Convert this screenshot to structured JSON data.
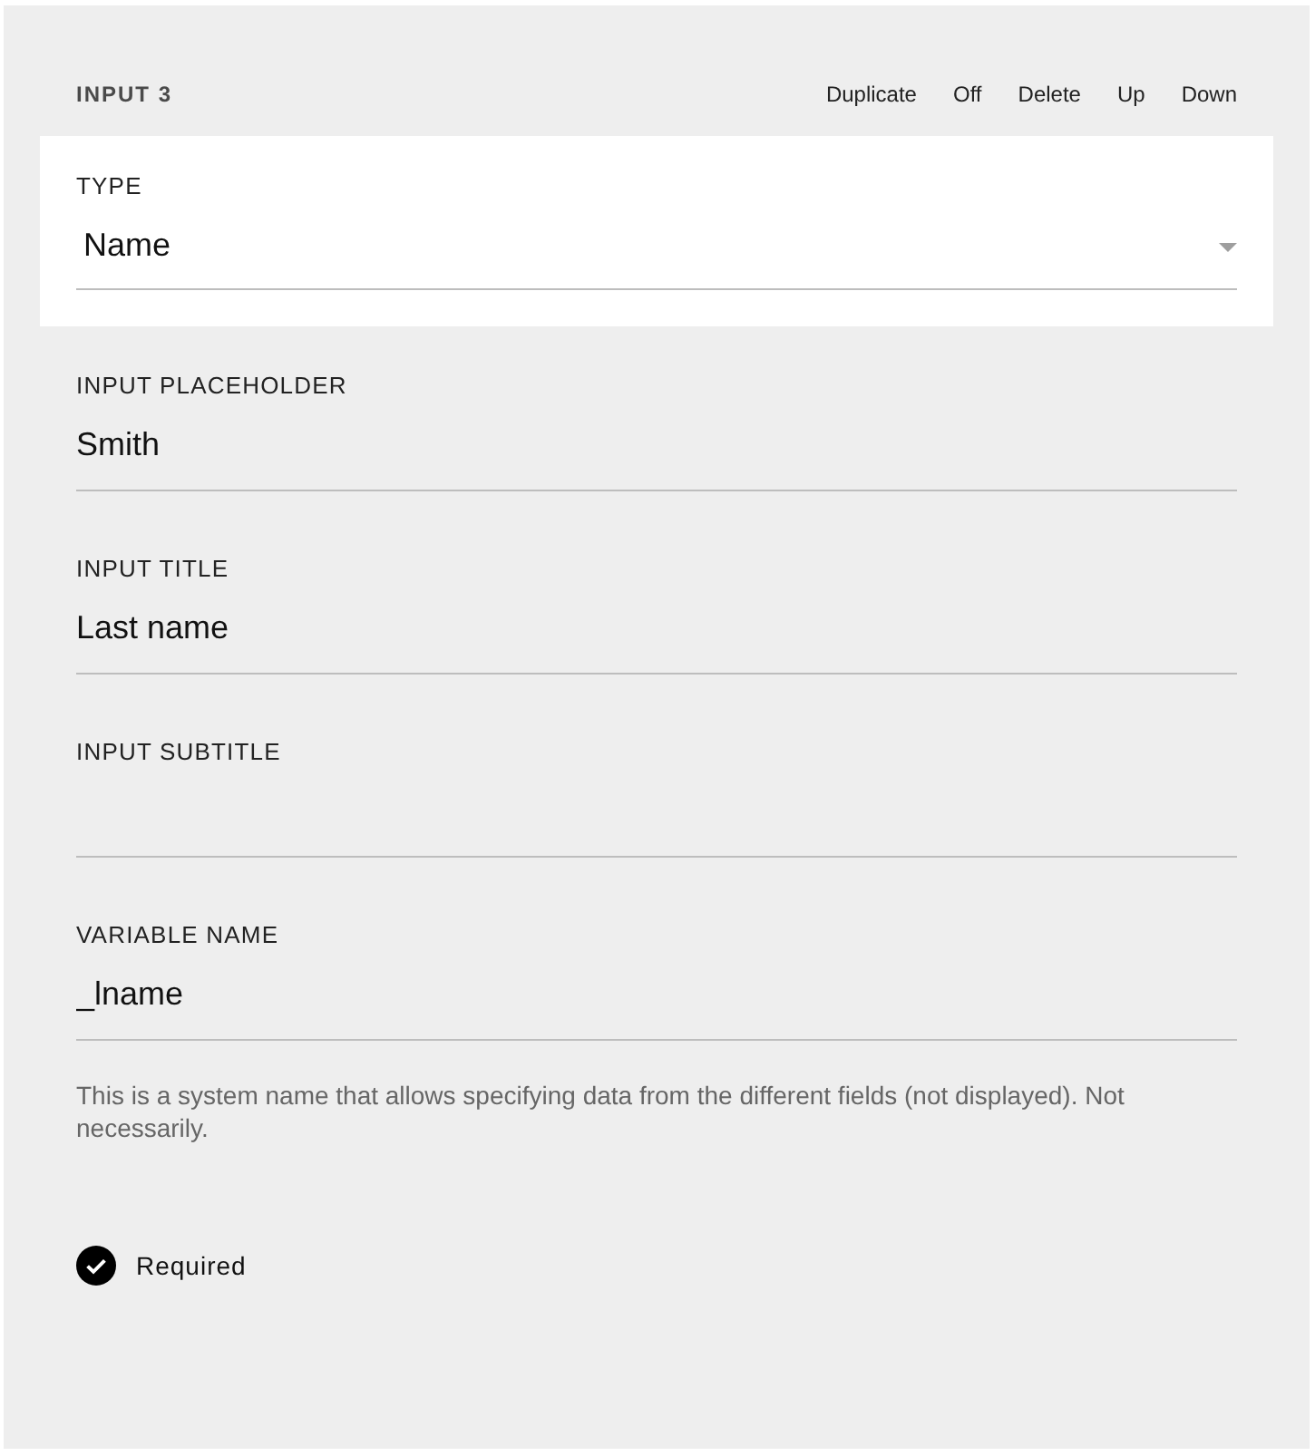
{
  "header": {
    "title": "INPUT 3",
    "actions": [
      "Duplicate",
      "Off",
      "Delete",
      "Up",
      "Down"
    ]
  },
  "type_select": {
    "label": "TYPE",
    "value": "Name"
  },
  "fields": [
    {
      "label": "INPUT PLACEHOLDER",
      "value": "Smith"
    },
    {
      "label": "INPUT TITLE",
      "value": "Last name"
    },
    {
      "label": "INPUT SUBTITLE"
    },
    {
      "label": "VARIABLE NAME",
      "value": "_lname"
    }
  ],
  "help_text": "This is a system name that allows specifying data from the different fields (not displayed). Not necessarily.",
  "required": {
    "label": "Required",
    "checked": true
  }
}
